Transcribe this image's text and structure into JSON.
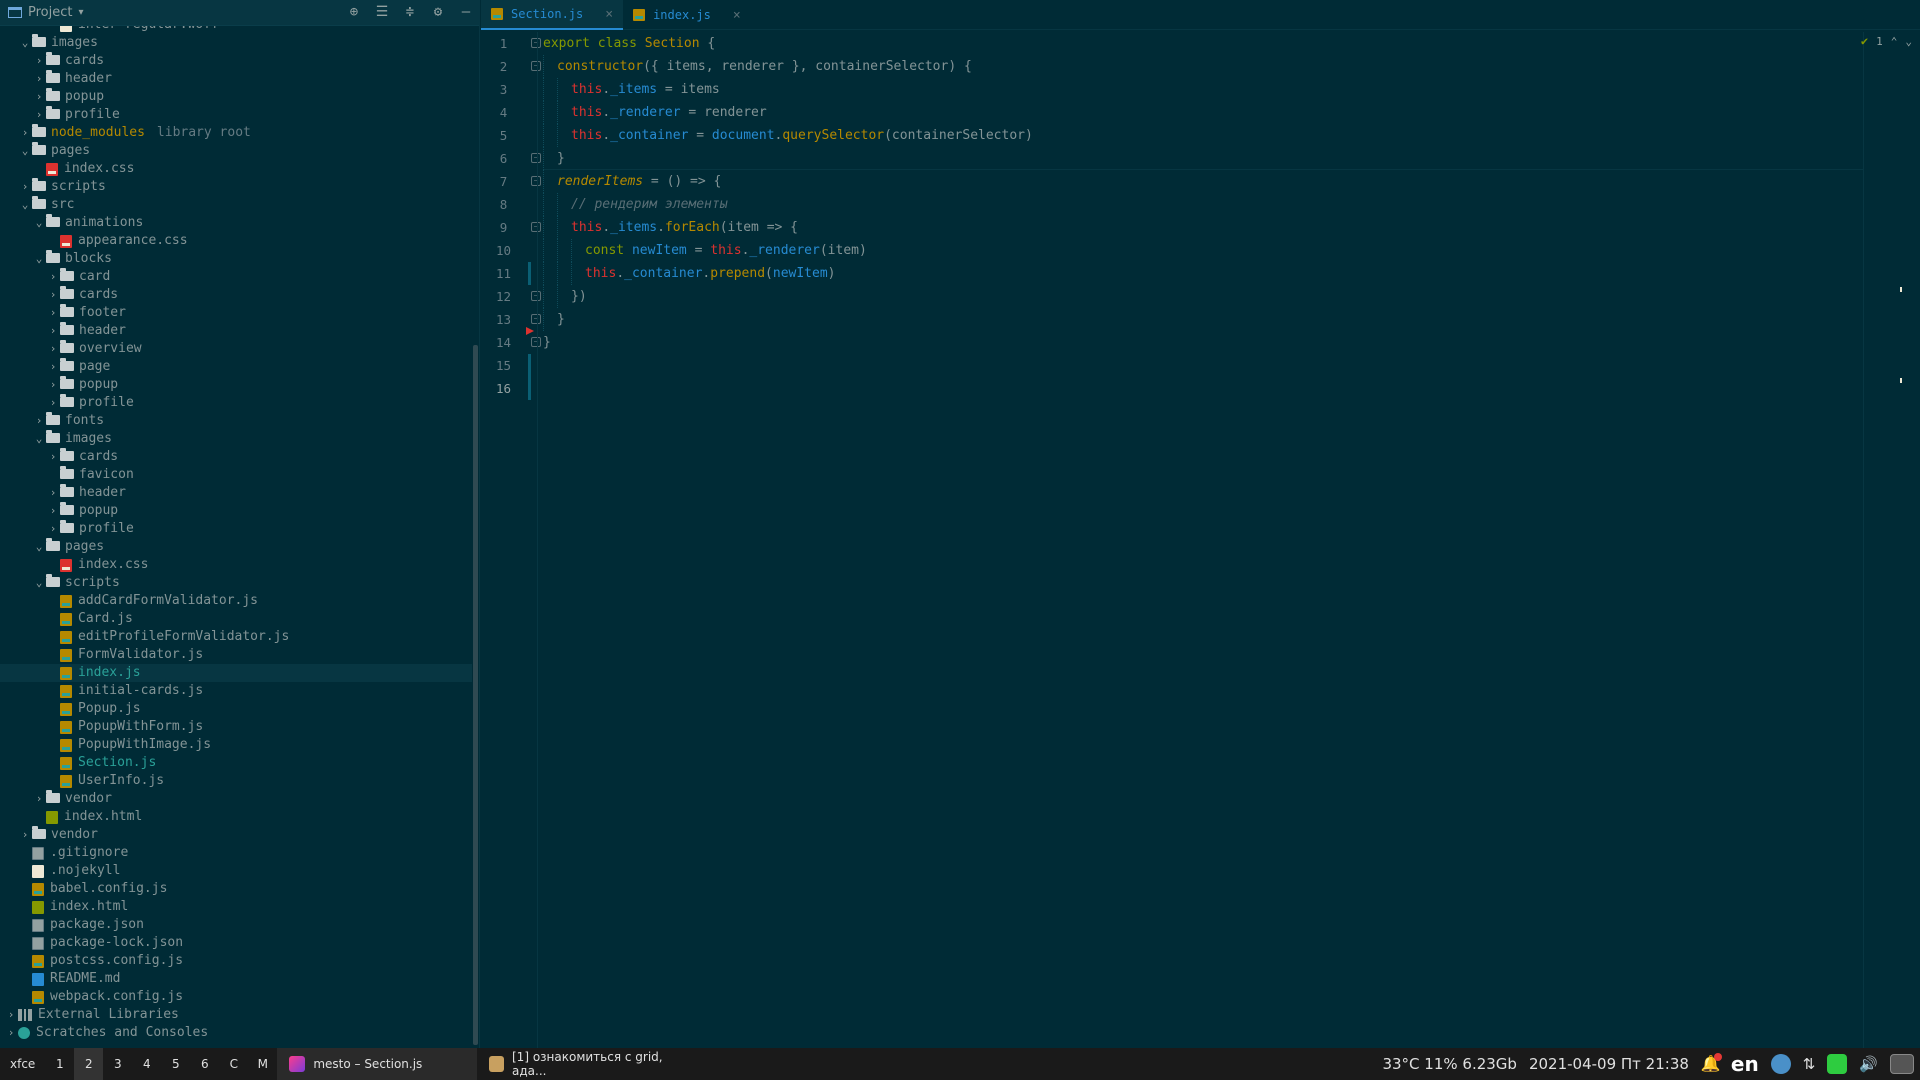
{
  "project": {
    "title": "Project",
    "tools": [
      "locate-icon",
      "expand-all-icon",
      "collapse-all-icon",
      "gear-icon",
      "hide-icon"
    ],
    "tree": [
      {
        "depth": 3,
        "arrow": "none",
        "icon": "font",
        "label": "inter-regular.woff"
      },
      {
        "depth": 1,
        "arrow": "open",
        "icon": "folder",
        "label": "images"
      },
      {
        "depth": 2,
        "arrow": "closed",
        "icon": "folder",
        "label": "cards"
      },
      {
        "depth": 2,
        "arrow": "closed",
        "icon": "folder",
        "label": "header"
      },
      {
        "depth": 2,
        "arrow": "closed",
        "icon": "folder",
        "label": "popup"
      },
      {
        "depth": 2,
        "arrow": "closed",
        "icon": "folder",
        "label": "profile"
      },
      {
        "depth": 1,
        "arrow": "closed",
        "icon": "folder",
        "label": "node_modules",
        "style": "yellow",
        "hint": "library root"
      },
      {
        "depth": 1,
        "arrow": "open",
        "icon": "folder",
        "label": "pages"
      },
      {
        "depth": 2,
        "arrow": "none",
        "icon": "css",
        "label": "index.css"
      },
      {
        "depth": 1,
        "arrow": "closed",
        "icon": "folder",
        "label": "scripts"
      },
      {
        "depth": 1,
        "arrow": "open",
        "icon": "folder",
        "label": "src"
      },
      {
        "depth": 2,
        "arrow": "open",
        "icon": "folder",
        "label": "animations"
      },
      {
        "depth": 3,
        "arrow": "none",
        "icon": "css",
        "label": "appearance.css"
      },
      {
        "depth": 2,
        "arrow": "open",
        "icon": "folder",
        "label": "blocks"
      },
      {
        "depth": 3,
        "arrow": "closed",
        "icon": "folder",
        "label": "card"
      },
      {
        "depth": 3,
        "arrow": "closed",
        "icon": "folder",
        "label": "cards"
      },
      {
        "depth": 3,
        "arrow": "closed",
        "icon": "folder",
        "label": "footer"
      },
      {
        "depth": 3,
        "arrow": "closed",
        "icon": "folder",
        "label": "header"
      },
      {
        "depth": 3,
        "arrow": "closed",
        "icon": "folder",
        "label": "overview"
      },
      {
        "depth": 3,
        "arrow": "closed",
        "icon": "folder",
        "label": "page"
      },
      {
        "depth": 3,
        "arrow": "closed",
        "icon": "folder",
        "label": "popup"
      },
      {
        "depth": 3,
        "arrow": "closed",
        "icon": "folder",
        "label": "profile"
      },
      {
        "depth": 2,
        "arrow": "closed",
        "icon": "folder",
        "label": "fonts"
      },
      {
        "depth": 2,
        "arrow": "open",
        "icon": "folder",
        "label": "images"
      },
      {
        "depth": 3,
        "arrow": "closed",
        "icon": "folder",
        "label": "cards"
      },
      {
        "depth": 3,
        "arrow": "none",
        "icon": "folder",
        "label": "favicon"
      },
      {
        "depth": 3,
        "arrow": "closed",
        "icon": "folder",
        "label": "header"
      },
      {
        "depth": 3,
        "arrow": "closed",
        "icon": "folder",
        "label": "popup"
      },
      {
        "depth": 3,
        "arrow": "closed",
        "icon": "folder",
        "label": "profile"
      },
      {
        "depth": 2,
        "arrow": "open",
        "icon": "folder",
        "label": "pages"
      },
      {
        "depth": 3,
        "arrow": "none",
        "icon": "css",
        "label": "index.css"
      },
      {
        "depth": 2,
        "arrow": "open",
        "icon": "folder",
        "label": "scripts"
      },
      {
        "depth": 3,
        "arrow": "none",
        "icon": "js",
        "label": "addCardFormValidator.js"
      },
      {
        "depth": 3,
        "arrow": "none",
        "icon": "js",
        "label": "Card.js"
      },
      {
        "depth": 3,
        "arrow": "none",
        "icon": "js",
        "label": "editProfileFormValidator.js"
      },
      {
        "depth": 3,
        "arrow": "none",
        "icon": "js",
        "label": "FormValidator.js"
      },
      {
        "depth": 3,
        "arrow": "none",
        "icon": "js",
        "label": "index.js",
        "style": "accent",
        "selected": true
      },
      {
        "depth": 3,
        "arrow": "none",
        "icon": "js",
        "label": "initial-cards.js"
      },
      {
        "depth": 3,
        "arrow": "none",
        "icon": "js",
        "label": "Popup.js"
      },
      {
        "depth": 3,
        "arrow": "none",
        "icon": "js",
        "label": "PopupWithForm.js"
      },
      {
        "depth": 3,
        "arrow": "none",
        "icon": "js",
        "label": "PopupWithImage.js"
      },
      {
        "depth": 3,
        "arrow": "none",
        "icon": "js",
        "label": "Section.js",
        "style": "accent"
      },
      {
        "depth": 3,
        "arrow": "none",
        "icon": "js",
        "label": "UserInfo.js"
      },
      {
        "depth": 2,
        "arrow": "closed",
        "icon": "folder",
        "label": "vendor"
      },
      {
        "depth": 2,
        "arrow": "none",
        "icon": "html",
        "label": "index.html"
      },
      {
        "depth": 1,
        "arrow": "closed",
        "icon": "folder",
        "label": "vendor"
      },
      {
        "depth": 1,
        "arrow": "none",
        "icon": "json",
        "label": ".gitignore"
      },
      {
        "depth": 1,
        "arrow": "none",
        "icon": "plain",
        "label": ".nojekyll"
      },
      {
        "depth": 1,
        "arrow": "none",
        "icon": "js",
        "label": "babel.config.js"
      },
      {
        "depth": 1,
        "arrow": "none",
        "icon": "html",
        "label": "index.html"
      },
      {
        "depth": 1,
        "arrow": "none",
        "icon": "json",
        "label": "package.json"
      },
      {
        "depth": 1,
        "arrow": "none",
        "icon": "json",
        "label": "package-lock.json"
      },
      {
        "depth": 1,
        "arrow": "none",
        "icon": "js",
        "label": "postcss.config.js"
      },
      {
        "depth": 1,
        "arrow": "none",
        "icon": "md",
        "label": "README.md"
      },
      {
        "depth": 1,
        "arrow": "none",
        "icon": "js",
        "label": "webpack.config.js"
      },
      {
        "depth": 0,
        "arrow": "closed",
        "icon": "lib",
        "label": "External Libraries"
      },
      {
        "depth": 0,
        "arrow": "closed",
        "icon": "scratch",
        "label": "Scratches and Consoles"
      }
    ]
  },
  "editor": {
    "tabs": [
      {
        "label": "Section.js",
        "active": true
      },
      {
        "label": "index.js",
        "active": false
      }
    ],
    "inspection": {
      "count": "1"
    },
    "current_line": 16,
    "lines": [
      [
        {
          "t": "export class ",
          "c": "kw"
        },
        {
          "t": "Section",
          "c": "cls"
        },
        {
          "t": " {",
          "c": ""
        }
      ],
      [
        {
          "i": 1
        },
        {
          "t": "constructor",
          "c": "fn"
        },
        {
          "t": "({ items, renderer }, containerSelector) {",
          "c": ""
        }
      ],
      [
        {
          "i": 2
        },
        {
          "t": "this",
          "c": "this"
        },
        {
          "t": ".",
          "c": ""
        },
        {
          "t": "_items",
          "c": "prop"
        },
        {
          "t": " = items",
          "c": ""
        }
      ],
      [
        {
          "i": 2
        },
        {
          "t": "this",
          "c": "this"
        },
        {
          "t": ".",
          "c": ""
        },
        {
          "t": "_renderer",
          "c": "prop"
        },
        {
          "t": " = renderer",
          "c": ""
        }
      ],
      [
        {
          "i": 2
        },
        {
          "t": "this",
          "c": "this"
        },
        {
          "t": ".",
          "c": ""
        },
        {
          "t": "_container",
          "c": "prop"
        },
        {
          "t": " = ",
          "c": ""
        },
        {
          "t": "document",
          "c": "prop"
        },
        {
          "t": ".",
          "c": ""
        },
        {
          "t": "querySelector",
          "c": "fn"
        },
        {
          "t": "(containerSelector)",
          "c": ""
        }
      ],
      [
        {
          "i": 1
        },
        {
          "t": "}",
          "c": ""
        }
      ],
      [
        {
          "i": 1
        },
        {
          "t": "renderItems",
          "c": "ital"
        },
        {
          "t": " = () => {",
          "c": ""
        }
      ],
      [
        {
          "i": 2
        },
        {
          "t": "// рендерим элементы",
          "c": "cmt"
        }
      ],
      [
        {
          "i": 2
        },
        {
          "t": "this",
          "c": "this"
        },
        {
          "t": ".",
          "c": ""
        },
        {
          "t": "_items",
          "c": "prop"
        },
        {
          "t": ".",
          "c": ""
        },
        {
          "t": "forEach",
          "c": "fn"
        },
        {
          "t": "(item => {",
          "c": ""
        }
      ],
      [
        {
          "i": 3
        },
        {
          "t": "const ",
          "c": "kw"
        },
        {
          "t": "newItem",
          "c": "var"
        },
        {
          "t": " = ",
          "c": ""
        },
        {
          "t": "this",
          "c": "this"
        },
        {
          "t": ".",
          "c": ""
        },
        {
          "t": "_renderer",
          "c": "prop"
        },
        {
          "t": "(item)",
          "c": ""
        }
      ],
      [
        {
          "i": 3
        },
        {
          "t": "this",
          "c": "this"
        },
        {
          "t": ".",
          "c": ""
        },
        {
          "t": "_container",
          "c": "prop"
        },
        {
          "t": ".",
          "c": ""
        },
        {
          "t": "prepend",
          "c": "fn"
        },
        {
          "t": "(",
          "c": ""
        },
        {
          "t": "newItem",
          "c": "var"
        },
        {
          "t": ")",
          "c": ""
        }
      ],
      [
        {
          "i": 2
        },
        {
          "t": "})",
          "c": ""
        }
      ],
      [
        {
          "i": 1
        },
        {
          "t": "}",
          "c": ""
        }
      ],
      [
        {
          "t": "}",
          "c": ""
        }
      ],
      [],
      []
    ]
  },
  "taskbar": {
    "menu": "xfce",
    "workspaces": [
      "1",
      "2",
      "3",
      "4",
      "5",
      "6",
      "C",
      "M"
    ],
    "active_workspace": "2",
    "tasks": [
      {
        "label": "mesto – Section.js",
        "icon": "ide",
        "active": true
      },
      {
        "label": "[1] ознакомиться с grid, ада...",
        "icon": "folder",
        "active": false
      }
    ],
    "status": "33°C 11% 6.23Gb",
    "datetime": "2021-04-09 Пт 21:38",
    "lang": "en"
  },
  "colors": {
    "background": "#002b36",
    "keyword": "#859900",
    "class": "#b58900",
    "this": "#dc322f",
    "property": "#268bd2",
    "comment": "#586e75"
  }
}
